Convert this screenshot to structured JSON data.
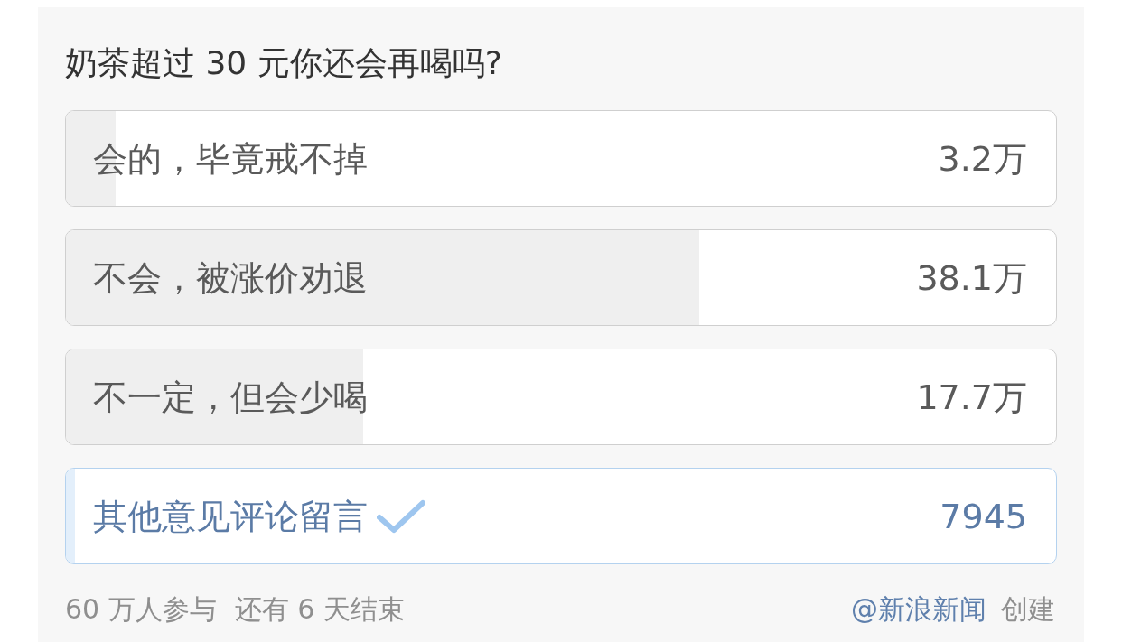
{
  "poll": {
    "question": "奶茶超过 30 元你还会再喝吗?",
    "options": [
      {
        "label": "会的，毕竟戒不掉",
        "count": "3.2万",
        "level": 0.05,
        "selected": false
      },
      {
        "label": "不会，被涨价劝退",
        "count": "38.1万",
        "level": 0.64,
        "selected": false
      },
      {
        "label": "不一定，但会少喝",
        "count": "17.7万",
        "level": 0.3,
        "selected": false
      },
      {
        "label": "其他意见评论留言",
        "count": "7945",
        "level": 0.009,
        "selected": true
      }
    ],
    "footer": {
      "participants": "60 万人参与",
      "remaining": "还有 6 天结束",
      "creator": "@新浪新闻",
      "created": "创建"
    }
  }
}
